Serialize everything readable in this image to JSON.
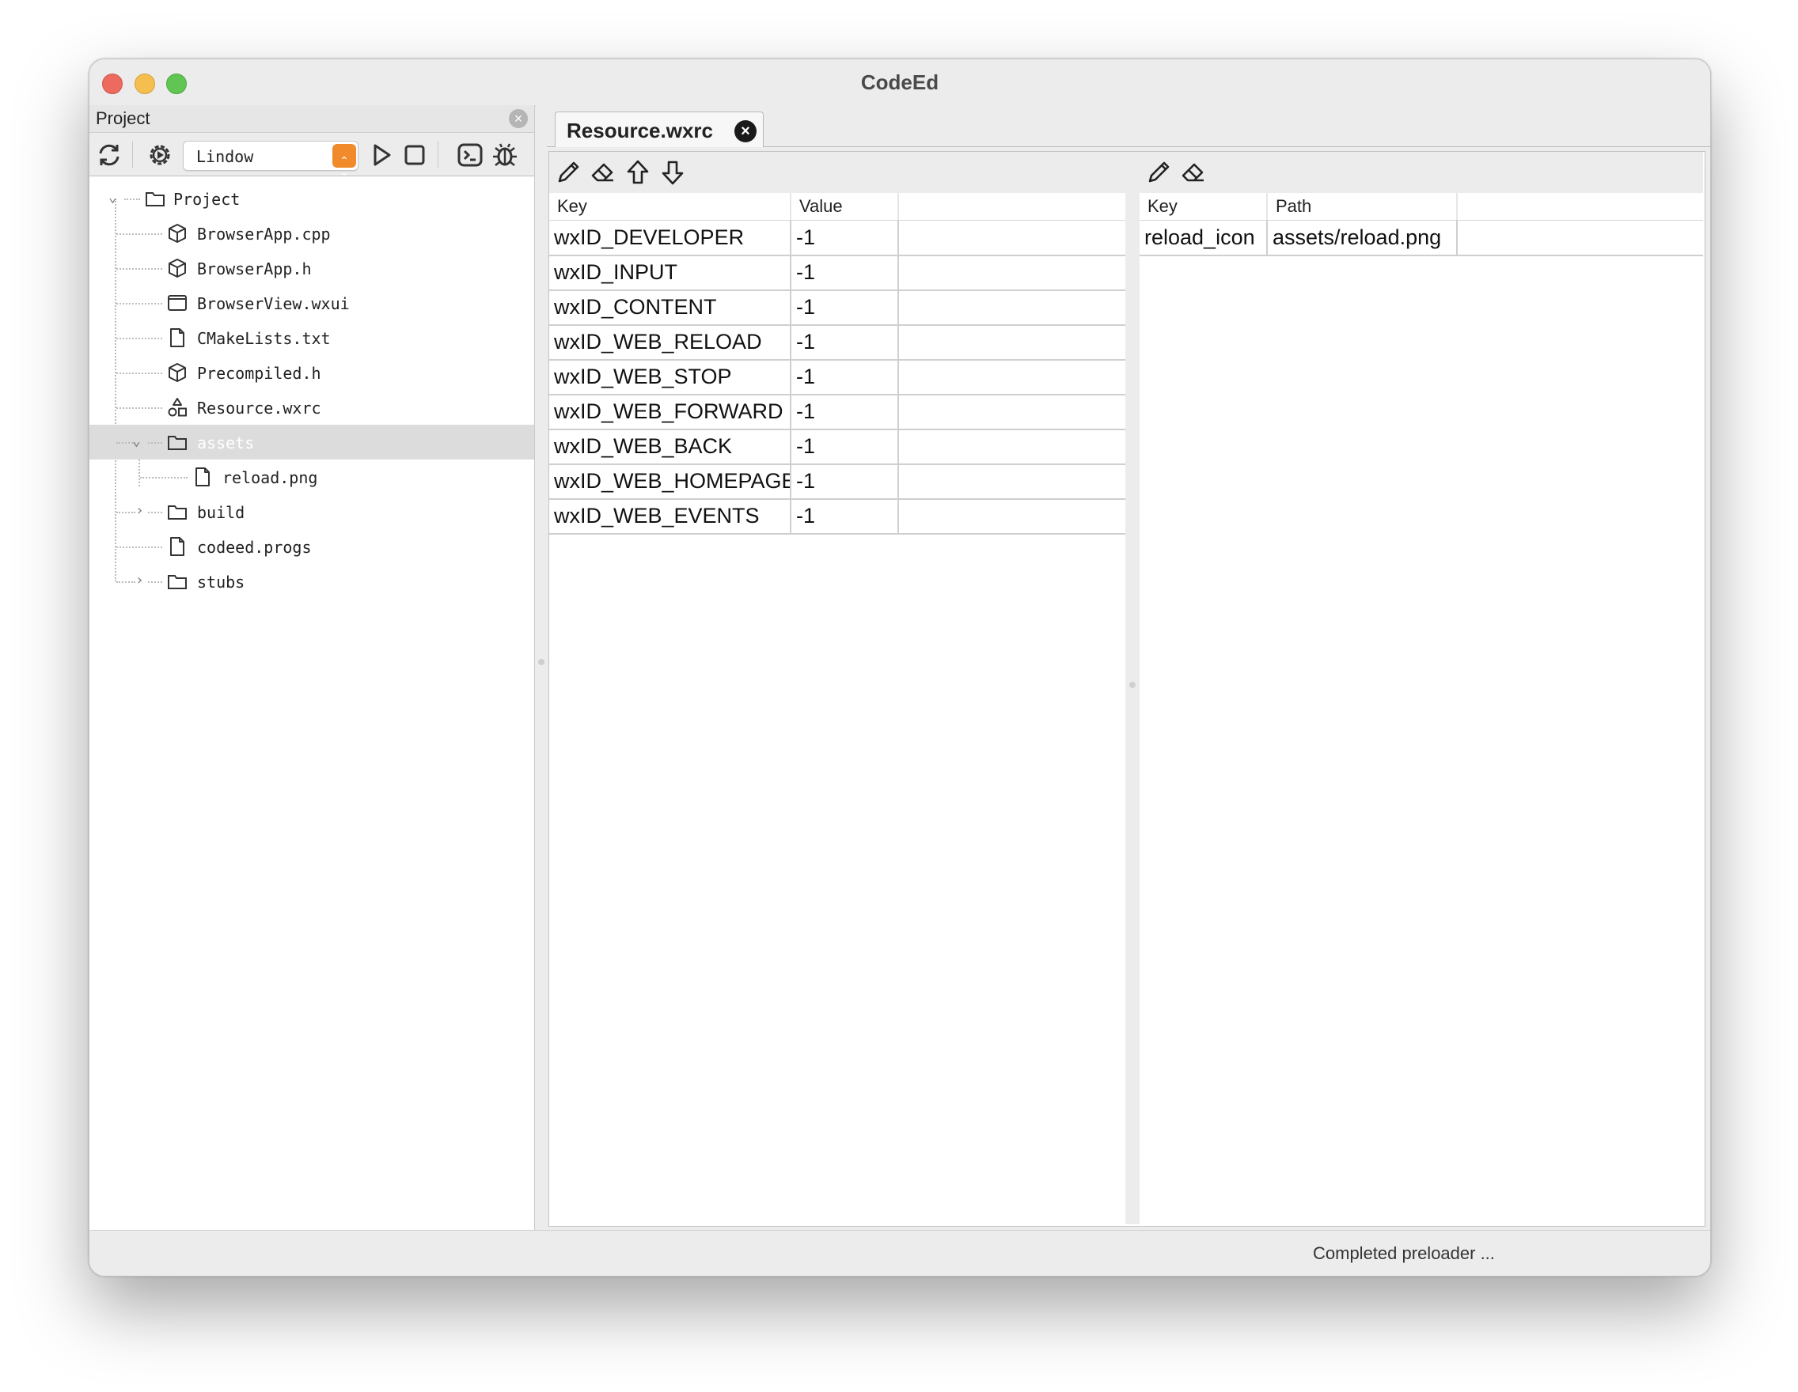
{
  "window": {
    "title": "CodeEd"
  },
  "project_panel": {
    "caption": "Project",
    "toolbar": {
      "refresh_icon": "refresh-icon",
      "settings_icon": "gear-icon",
      "target_select": {
        "value": "Lindow"
      },
      "run_icon": "play-icon",
      "stop_icon": "stop-icon",
      "terminal_icon": "terminal-icon",
      "debug_icon": "bug-icon"
    },
    "tree": [
      {
        "label": "Project",
        "icon": "folder-icon",
        "expanded": true
      },
      {
        "label": "BrowserApp.cpp",
        "icon": "cube-icon"
      },
      {
        "label": "BrowserApp.h",
        "icon": "cube-icon"
      },
      {
        "label": "BrowserView.wxui",
        "icon": "window-icon"
      },
      {
        "label": "CMakeLists.txt",
        "icon": "file-icon"
      },
      {
        "label": "Precompiled.h",
        "icon": "cube-icon"
      },
      {
        "label": "Resource.wxrc",
        "icon": "shapes-icon"
      },
      {
        "label": "assets",
        "icon": "folder-icon",
        "expanded": true,
        "selected": true
      },
      {
        "label": "reload.png",
        "icon": "file-icon"
      },
      {
        "label": "build",
        "icon": "folder-icon",
        "expanded": false
      },
      {
        "label": "codeed.progs",
        "icon": "file-icon"
      },
      {
        "label": "stubs",
        "icon": "folder-icon",
        "expanded": false
      }
    ]
  },
  "editor": {
    "tab": {
      "label": "Resource.wxrc"
    },
    "ids_table": {
      "headers": [
        "Key",
        "Value"
      ],
      "rows": [
        [
          "wxID_DEVELOPER",
          "-1"
        ],
        [
          "wxID_INPUT",
          "-1"
        ],
        [
          "wxID_CONTENT",
          "-1"
        ],
        [
          "wxID_WEB_RELOAD",
          "-1"
        ],
        [
          "wxID_WEB_STOP",
          "-1"
        ],
        [
          "wxID_WEB_FORWARD",
          "-1"
        ],
        [
          "wxID_WEB_BACK",
          "-1"
        ],
        [
          "wxID_WEB_HOMEPAGE",
          "-1"
        ],
        [
          "wxID_WEB_EVENTS",
          "-1"
        ]
      ]
    },
    "files_table": {
      "headers": [
        "Key",
        "Path"
      ],
      "rows": [
        [
          "reload_icon",
          "assets/reload.png"
        ]
      ]
    }
  },
  "status": {
    "text": "Completed preloader ..."
  },
  "colors": {
    "accent_select": "#f08a2b",
    "traffic_close": "#ec6a5e",
    "traffic_min": "#f4bf4f",
    "traffic_max": "#61c554"
  }
}
